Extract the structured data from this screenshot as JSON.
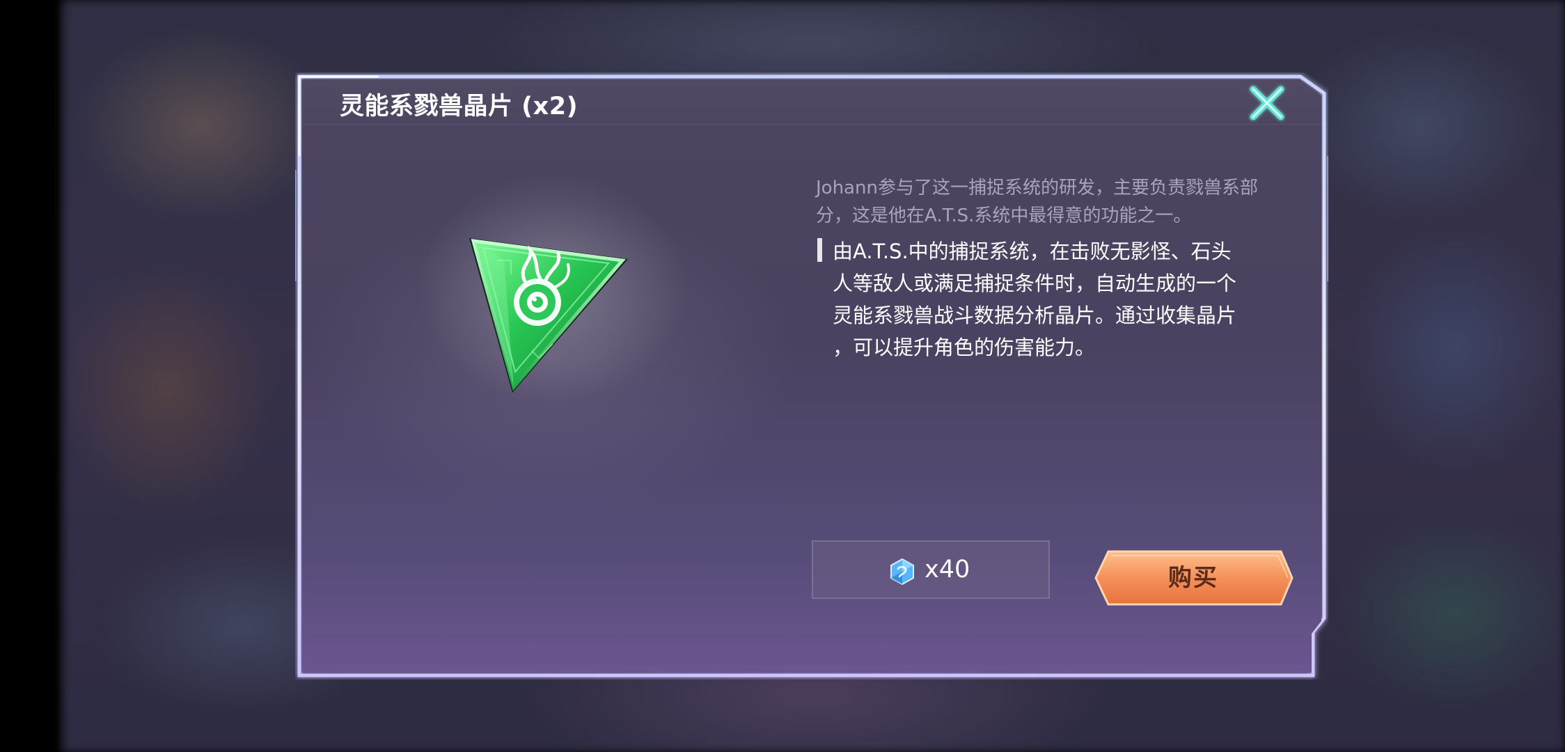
{
  "dialog": {
    "title": "灵能系戮兽晶片 (x2)",
    "close_icon": "close-x-icon",
    "item_icon": "green-triangle-crystal-icon",
    "lore": "Johann参与了这一捕捉系统的研发，主要负责戮兽系部分，这是他在A.T.S.系统中最得意的功能之一。",
    "description_lines": [
      "由A.T.S.中的捕捉系统，在击败无影怪、石头",
      "人等敌人或满足捕捉条件时，自动生成的一个",
      "灵能系戮兽战斗数据分析晶片。通过收集晶片",
      "，可以提升角色的伤害能力。"
    ],
    "price": {
      "currency_icon": "blue-crystal-currency-icon",
      "amount": "x40"
    },
    "buy_label": "购买"
  },
  "colors": {
    "accent_cyan": "#5fe3d6",
    "buy_button": "#f0915e",
    "crystal_green": "#2fc95a",
    "currency_blue": "#4aa8ff"
  }
}
